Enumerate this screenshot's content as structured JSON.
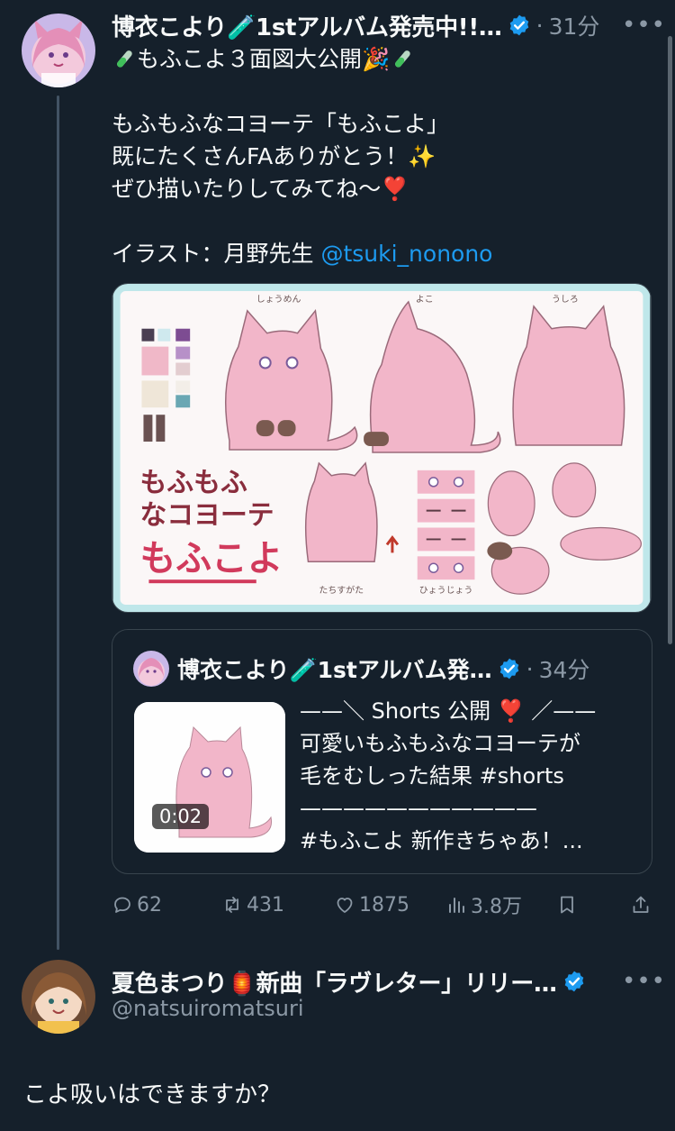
{
  "tweet": {
    "author_name": "博衣こより🧪1stアルバム発売中!!…",
    "time": "31分",
    "lines": [
      "もふこよ３面図大公開🎉",
      "もふもふなコヨーテ「もふこよ」",
      "既にたくさんFAありがとう！✨",
      "ぜひ描いたりしてみてね〜❣️"
    ],
    "credit_prefix": "イラスト：月野先生 ",
    "credit_mention": "@tsuki_nonono",
    "image": {
      "label_front": "しょうめん",
      "label_side": "よこ",
      "label_back": "うしろ",
      "title_line1": "もふもふ",
      "title_line2": "なコヨーテ",
      "title_line3": "もふこよ",
      "label_standing": "たちすがた",
      "label_expression": "ひょうじょう"
    }
  },
  "quote": {
    "author_name": "博衣こより🧪1stアルバム発…",
    "time": "34分",
    "duration": "0:02",
    "lines": [
      "——＼ Shorts 公開 ❣️ ／——",
      "可愛いもふもふなコヨーテが",
      "毛をむしった結果 #shorts",
      "———————————",
      "#もふこよ 新作きちゃあ！..."
    ]
  },
  "actions": {
    "replies": "62",
    "retweets": "431",
    "likes": "1875",
    "views": "3.8万"
  },
  "reply": {
    "author_name": "夏色まつり🏮新曲「ラヴレター」リリー…",
    "handle": "@natsuiromatsuri",
    "text": "こよ吸いはできますか？"
  },
  "colors": {
    "background": "#15202b",
    "text": "#f7f9f9",
    "muted": "#8b98a5",
    "link": "#1d9bf0",
    "border": "#38444d",
    "verified": "#1d9bf0"
  }
}
